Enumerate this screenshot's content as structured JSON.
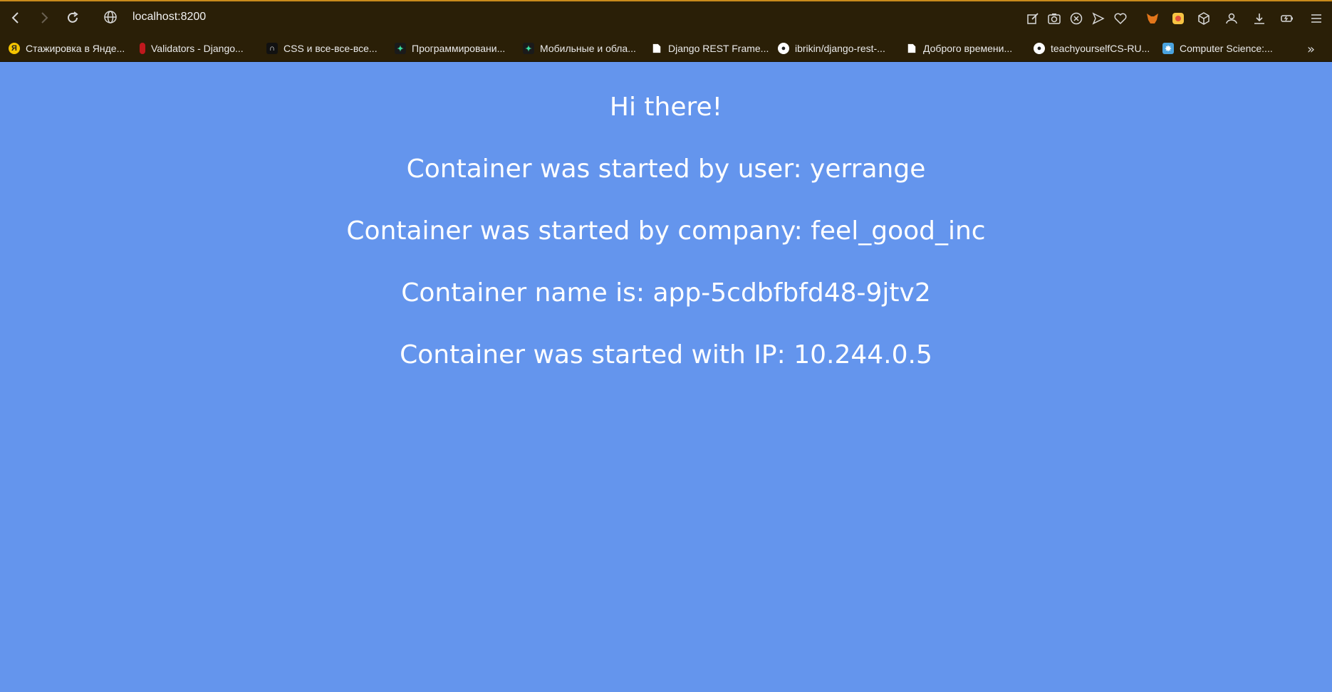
{
  "browser": {
    "url": "localhost:8200",
    "bookmarks": [
      {
        "label": "Стажировка в Янде...",
        "icon": "yandex-icon",
        "color": "#f5c400"
      },
      {
        "label": "Validators - Django...",
        "icon": "django-icon",
        "color": "#c0181d"
      },
      {
        "label": "CSS и все-все-все...",
        "icon": "habr-icon",
        "color": "#111111"
      },
      {
        "label": "Программировани...",
        "icon": "spark-icon",
        "color": "#1a1a1a"
      },
      {
        "label": "Мобильные и обла...",
        "icon": "spark-icon",
        "color": "#1a1a1a"
      },
      {
        "label": "Django REST Frame...",
        "icon": "document-icon",
        "color": "#ffffff"
      },
      {
        "label": "ibrikin/django-rest-...",
        "icon": "github-icon",
        "color": "#ffffff"
      },
      {
        "label": "Доброго времени...",
        "icon": "document-icon",
        "color": "#ffffff"
      },
      {
        "label": "teachyourselfCS-RU...",
        "icon": "github-icon",
        "color": "#ffffff"
      },
      {
        "label": "Computer Science:...",
        "icon": "cs-icon",
        "color": "#4aa3df"
      }
    ]
  },
  "page": {
    "greeting": "Hi there!",
    "user_line": "Container was started by user: yerrange",
    "company_line": "Container was started by company: feel_good_inc",
    "name_line": "Container name is: app-5cdbfbfd48-9jtv2",
    "ip_line": "Container was started with IP: 10.244.0.5",
    "background_color": "#6495ed"
  }
}
